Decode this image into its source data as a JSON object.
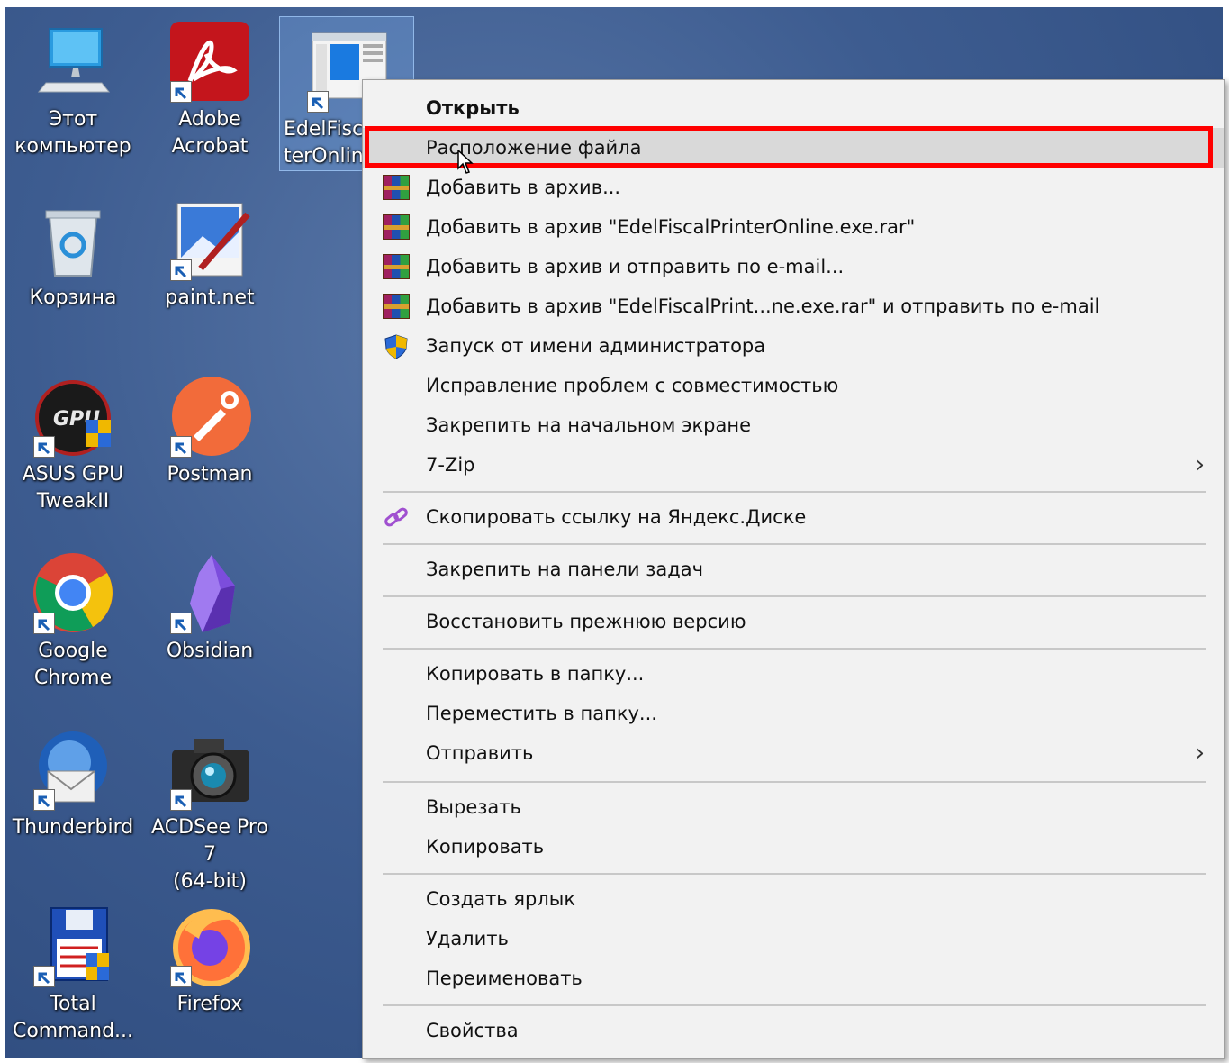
{
  "desktop_icons": [
    {
      "label": "Этот\nкомпьютер",
      "icon": "this-pc-icon",
      "shortcut": false
    },
    {
      "label": "Adobe\nAcrobat",
      "icon": "adobe-acrobat-icon",
      "shortcut": true
    },
    {
      "label": "EdelFisca\nterOnlin",
      "icon": "edel-fiscal-printer-icon",
      "shortcut": true,
      "selected": true
    },
    {
      "label": "Корзина",
      "icon": "recycle-bin-icon",
      "shortcut": false
    },
    {
      "label": "paint.net",
      "icon": "paint-net-icon",
      "shortcut": true
    },
    {
      "label": "ASUS GPU\nTweakII",
      "icon": "asus-gpu-tweak-icon",
      "shortcut": true
    },
    {
      "label": "Postman",
      "icon": "postman-icon",
      "shortcut": true
    },
    {
      "label": "Google\nChrome",
      "icon": "google-chrome-icon",
      "shortcut": true
    },
    {
      "label": "Obsidian",
      "icon": "obsidian-icon",
      "shortcut": true
    },
    {
      "label": "Thunderbird",
      "icon": "thunderbird-icon",
      "shortcut": true
    },
    {
      "label": "ACDSee Pro 7\n(64-bit)",
      "icon": "acdsee-camera-icon",
      "shortcut": true
    },
    {
      "label": "Total\nCommand...",
      "icon": "total-commander-icon",
      "shortcut": true
    },
    {
      "label": "Firefox",
      "icon": "firefox-icon",
      "shortcut": true
    }
  ],
  "context_menu": {
    "items": {
      "open": "Открыть",
      "file_location": "Расположение файла",
      "add_archive": "Добавить в архив...",
      "add_archive_named": "Добавить в архив \"EdelFiscalPrinterOnline.exe.rar\"",
      "add_archive_email": "Добавить в архив и отправить по e-mail...",
      "add_archive_named_email": "Добавить в архив \"EdelFiscalPrint...ne.exe.rar\" и отправить по e-mail",
      "run_as_admin": "Запуск от имени администратора",
      "troubleshoot": "Исправление проблем с совместимостью",
      "pin_start": "Закрепить на начальном экране",
      "sevenzip": "7-Zip",
      "yandex_link": "Скопировать ссылку на Яндекс.Диске",
      "pin_taskbar": "Закрепить на панели задач",
      "restore_prev": "Восстановить прежнюю версию",
      "copy_to": "Копировать в папку...",
      "move_to": "Переместить в папку...",
      "send_to": "Отправить",
      "cut": "Вырезать",
      "copy": "Копировать",
      "create_shortcut": "Создать ярлык",
      "delete": "Удалить",
      "rename": "Переименовать",
      "properties": "Свойства"
    },
    "submenu_arrow": "›",
    "highlighted_item": "file_location",
    "highlight_color": "#ff0000"
  }
}
